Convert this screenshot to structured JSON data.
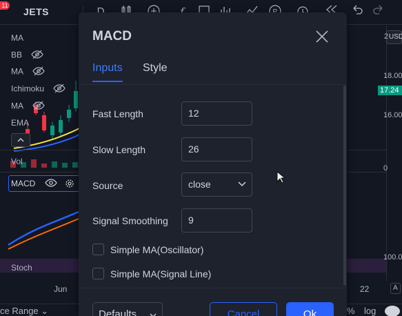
{
  "app": {
    "notification_count": "11",
    "symbol": "JETS",
    "legend_items": [
      "MA",
      "BB",
      "MA",
      "Ichimoku",
      "MA",
      "EMA"
    ],
    "volume_label": "Vol",
    "macd_label": "MACD",
    "stoch_label": "Stoch",
    "x_axis_label": "Jun",
    "x_axis_right": "22",
    "currency_button": "USD",
    "price_labels": [
      "2",
      "18.00",
      "16.00",
      "0",
      "100.0"
    ],
    "current_price": "17.24",
    "bottom_left": "ce Range",
    "bottom_percent": "%",
    "bottom_log": "log",
    "bottom_auto": "A"
  },
  "dialog": {
    "title": "MACD",
    "tabs": [
      {
        "label": "Inputs",
        "active": true
      },
      {
        "label": "Style",
        "active": false
      }
    ],
    "inputs": {
      "fast_length": {
        "label": "Fast Length",
        "value": "12"
      },
      "slow_length": {
        "label": "Slow Length",
        "value": "26"
      },
      "source": {
        "label": "Source",
        "value": "close"
      },
      "signal_smoothing": {
        "label": "Signal Smoothing",
        "value": "9"
      }
    },
    "checkboxes": [
      {
        "label": "Simple MA(Oscillator)",
        "checked": false
      },
      {
        "label": "Simple MA(Signal Line)",
        "checked": false
      }
    ],
    "footer": {
      "defaults_label": "Defaults",
      "cancel_label": "Cancel",
      "ok_label": "Ok"
    }
  },
  "colors": {
    "accent": "#2962ff",
    "dialog_bg": "#1e222d",
    "app_bg": "#131722",
    "up_candle": "#089981",
    "down_candle": "#f23645",
    "macd_line": "#2962ff",
    "signal_line": "#ff6d00"
  }
}
